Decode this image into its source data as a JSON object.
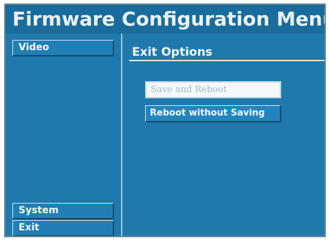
{
  "window": {
    "title": "Firmware Configuration Menu"
  },
  "sidebar": {
    "items": [
      {
        "label": "Video"
      },
      {
        "label": "System"
      },
      {
        "label": "Exit"
      }
    ]
  },
  "main": {
    "section_title": "Exit Options",
    "options": [
      {
        "label": "Save and Reboot",
        "state": "highlighted"
      },
      {
        "label": "Reboot without Saving",
        "state": "normal"
      }
    ]
  },
  "colors": {
    "background": "#1f79ad",
    "title_bar": "#1a6c9d",
    "text": "#f2f8fa",
    "highlight_bg": "#f5f9fb",
    "highlight_text": "#9fb8c4"
  }
}
